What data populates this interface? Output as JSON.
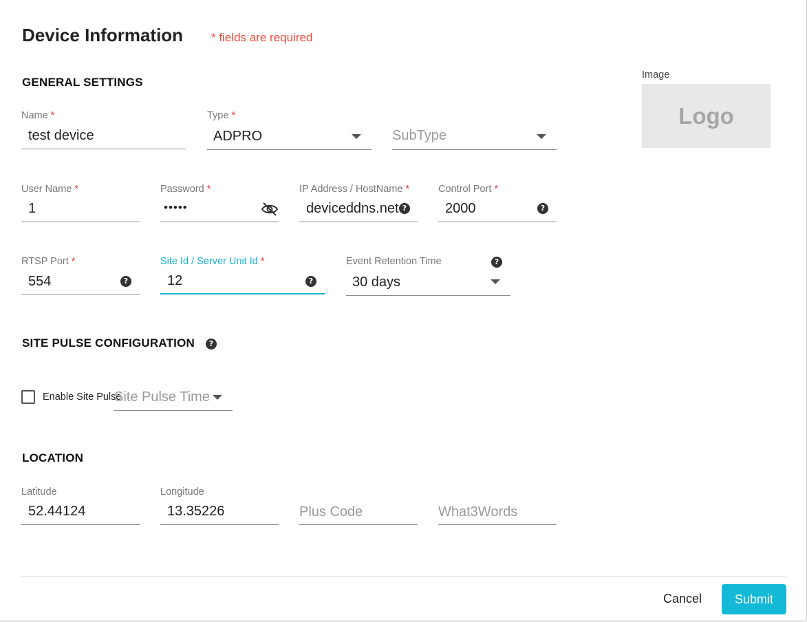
{
  "dialog": {
    "title": "Device Information",
    "required_note": "* fields are required"
  },
  "general": {
    "heading": "GENERAL SETTINGS",
    "name": {
      "label": "Name",
      "value": "test device"
    },
    "type": {
      "label": "Type",
      "value": "ADPRO"
    },
    "subtype": {
      "placeholder": "SubType"
    },
    "username": {
      "label": "User Name",
      "value": "1"
    },
    "password": {
      "label": "Password",
      "value": "•••••"
    },
    "ip": {
      "label": "IP Address / HostName",
      "value": "deviceddns.net"
    },
    "control_port": {
      "label": "Control Port",
      "value": "2000"
    },
    "rtsp_port": {
      "label": "RTSP Port",
      "value": "554"
    },
    "site_id": {
      "label": "Site Id / Server Unit Id",
      "value": "12"
    },
    "retention": {
      "label": "Event Retention Time",
      "value": "30 days"
    },
    "required_marker": "*"
  },
  "image": {
    "label": "Image",
    "logo_text": "Logo"
  },
  "site_pulse": {
    "heading": "SITE PULSE CONFIGURATION",
    "enable_label": "Enable Site Pulse",
    "enabled": false,
    "time_placeholder": "Site Pulse Time"
  },
  "location": {
    "heading": "LOCATION",
    "latitude": {
      "label": "Latitude",
      "value": "52.44124"
    },
    "longitude": {
      "label": "Longitude",
      "value": "13.35226"
    },
    "plus_code": {
      "placeholder": "Plus Code"
    },
    "what3words": {
      "placeholder": "What3Words"
    }
  },
  "footer": {
    "cancel_label": "Cancel",
    "submit_label": "Submit"
  },
  "icons": {
    "help": "?",
    "help_icon": "question-circle-icon",
    "dropdown_icon": "caret-down-icon",
    "visibility_icon": "eye-off-icon"
  },
  "colors": {
    "accent": "#14b9d8",
    "required": "#e53935",
    "note": "#e74c3c"
  }
}
